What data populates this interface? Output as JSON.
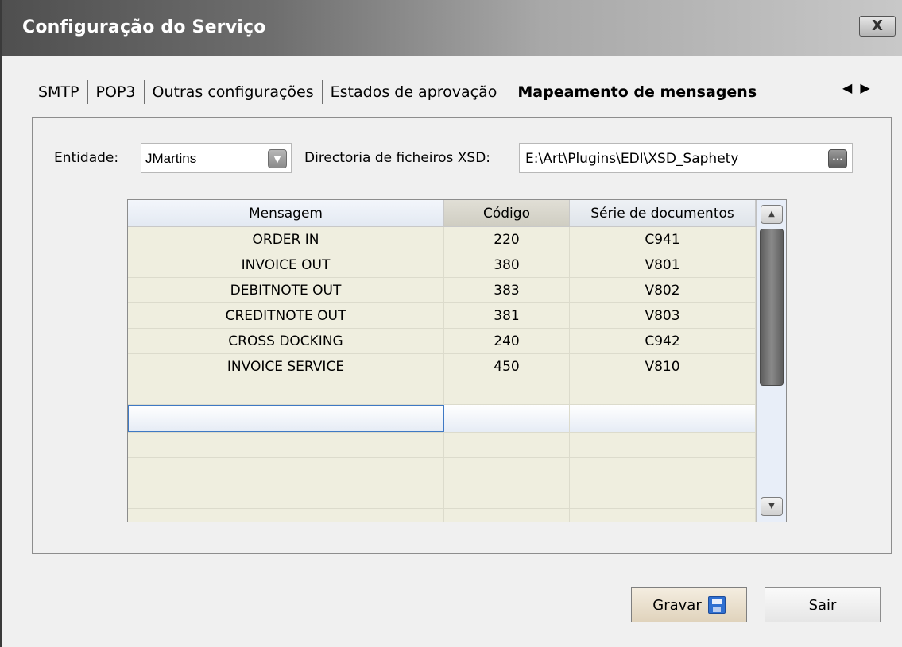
{
  "window": {
    "title": "Configuração do Serviço",
    "close_label": "X"
  },
  "tabs": [
    {
      "label": "SMTP",
      "active": false
    },
    {
      "label": "POP3",
      "active": false
    },
    {
      "label": "Outras configurações",
      "active": false
    },
    {
      "label": "Estados de aprovação",
      "active": false
    },
    {
      "label": "Mapeamento de mensagens",
      "active": true
    }
  ],
  "form": {
    "entity_label": "Entidade:",
    "entity_value": "JMartins",
    "xsd_label": "Directoria de ficheiros XSD:",
    "xsd_value": "E:\\Art\\Plugins\\EDI\\XSD_Saphety"
  },
  "grid": {
    "columns": [
      "Mensagem",
      "Código",
      "Série de documentos"
    ],
    "rows": [
      [
        "ORDER IN",
        "220",
        "C941"
      ],
      [
        "INVOICE OUT",
        "380",
        "V801"
      ],
      [
        "DEBITNOTE OUT",
        "383",
        "V802"
      ],
      [
        "CREDITNOTE OUT",
        "381",
        "V803"
      ],
      [
        "CROSS DOCKING",
        "240",
        "C942"
      ],
      [
        "INVOICE SERVICE",
        "450",
        "V810"
      ],
      [
        "",
        "",
        ""
      ],
      [
        "",
        "",
        ""
      ],
      [
        "",
        "",
        ""
      ],
      [
        "",
        "",
        ""
      ],
      [
        "",
        "",
        ""
      ],
      [
        "",
        "",
        ""
      ]
    ]
  },
  "buttons": {
    "save": "Gravar",
    "exit": "Sair"
  },
  "icons": {
    "close": "close-icon",
    "tab_left": "arrow-left-icon",
    "tab_right": "arrow-right-icon",
    "combo": "chevron-down-icon",
    "browse": "ellipsis-icon",
    "save": "floppy-disk-icon"
  }
}
